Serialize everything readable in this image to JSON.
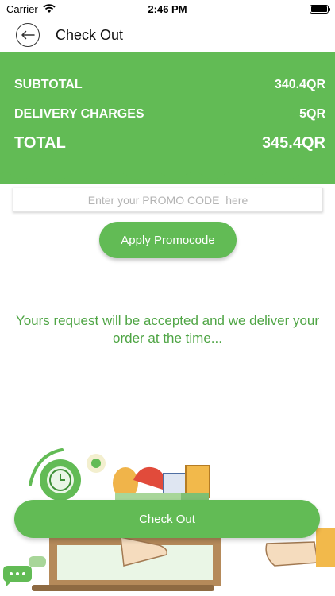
{
  "status_bar": {
    "carrier": "Carrier",
    "time": "2:46 PM"
  },
  "header": {
    "title": "Check Out"
  },
  "summary": {
    "subtotal_label": "SUBTOTAL",
    "subtotal_value": "340.4QR",
    "delivery_label": "DELIVERY CHARGES",
    "delivery_value": "5QR",
    "total_label": "TOTAL",
    "total_value": "345.4QR"
  },
  "promo": {
    "placeholder": "Enter your PROMO CODE  here",
    "value": "",
    "apply_label": "Apply Promocode"
  },
  "message": "Yours request will be accepted and we deliver your order at the time...",
  "checkout_label": "Check Out",
  "icons": [
    "wifi-icon",
    "battery-icon",
    "back-arrow-icon",
    "clock-icon",
    "flower-icon",
    "chat-bubble-icon",
    "grocery-bag-icon"
  ],
  "colors": {
    "accent": "#62bb55",
    "message_text": "#4fa545"
  }
}
